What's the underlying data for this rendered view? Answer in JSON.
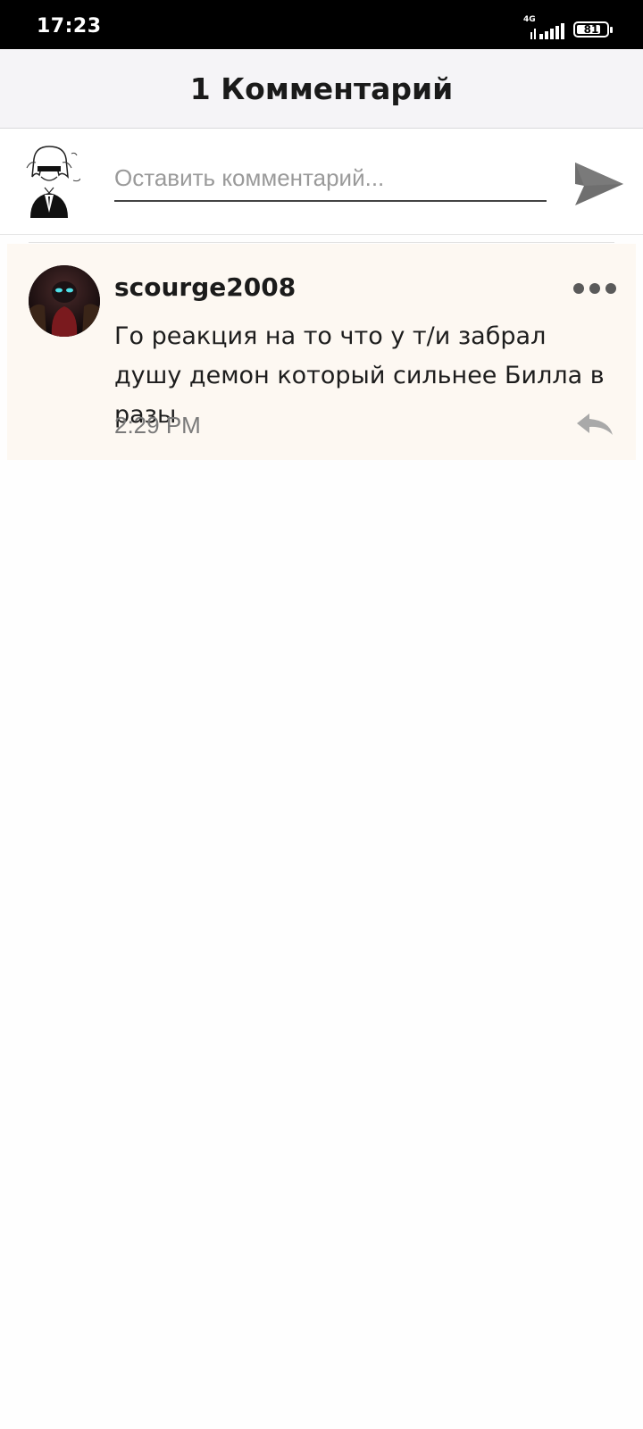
{
  "status_bar": {
    "time": "17:23",
    "network": "4G",
    "battery_level": "81",
    "battery_fraction": 0.81
  },
  "header": {
    "title": "1 Комментарий"
  },
  "compose": {
    "placeholder": "Оставить комментарий...",
    "value": ""
  },
  "comments": [
    {
      "author": "scourge2008",
      "text": "Го реакция на то что у т/и забрал душу демон который сильнее Билла в разы",
      "time": "2:29 PM"
    }
  ],
  "colors": {
    "header_bg": "#f5f4f7",
    "comment_bg": "#fdf8f2",
    "icon_gray": "#6f6f6f"
  }
}
